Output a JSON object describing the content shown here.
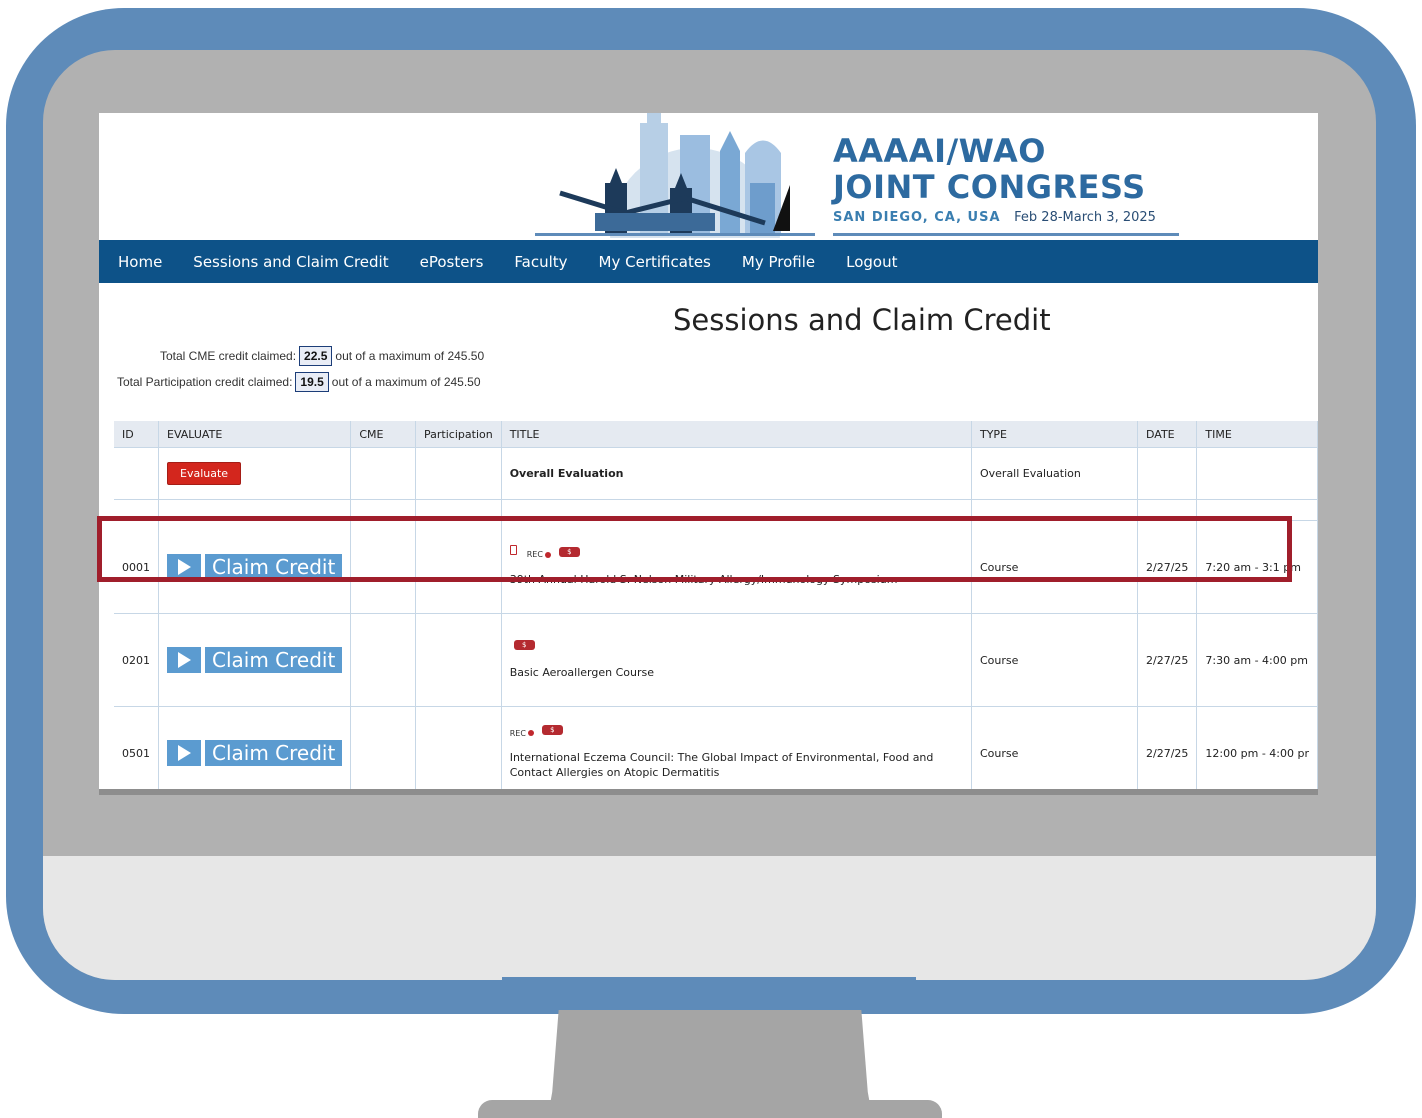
{
  "brand": {
    "line1": "AAAAI/WAO",
    "line2": "JOINT CONGRESS",
    "location": "SAN DIEGO, CA, USA",
    "dates": "Feb 28-March 3, 2025"
  },
  "nav": {
    "items": [
      "Home",
      "Sessions and Claim Credit",
      "ePosters",
      "Faculty",
      "My Certificates",
      "My Profile",
      "Logout"
    ]
  },
  "page_title": "Sessions and Claim Credit",
  "credits": {
    "cme_label": "Total CME credit claimed:",
    "cme_value": "22.5",
    "cme_suffix": "out of a maximum of 245.50",
    "participation_label": "Total Participation credit claimed:",
    "participation_value": "19.5",
    "participation_suffix": "out of a maximum of 245.50"
  },
  "table": {
    "headers": [
      "ID",
      "EVALUATE",
      "CME",
      "Participation",
      "TITLE",
      "TYPE",
      "DATE",
      "TIME"
    ],
    "overall": {
      "button": "Evaluate",
      "title": "Overall Evaluation",
      "type": "Overall Evaluation"
    },
    "rows": [
      {
        "id": "0001",
        "action": "Claim Credit",
        "rec": "REC",
        "badge": "$",
        "title": "39th Annual Harold S. Nelson Military Allergy/Immunology Symposium",
        "type": "Course",
        "date": "2/27/25",
        "time": "7:20 am - 3:1  pm"
      },
      {
        "id": "0201",
        "action": "Claim Credit",
        "badge": "$",
        "title": "Basic Aeroallergen Course",
        "type": "Course",
        "date": "2/27/25",
        "time": "7:30 am - 4:00 pm"
      },
      {
        "id": "0501",
        "action": "Claim Credit",
        "rec": "REC",
        "badge": "$",
        "title": "International Eczema Council: The Global Impact of Environmental, Food and Contact Allergies on Atopic Dermatitis",
        "type": "Course",
        "date": "2/27/25",
        "time": "12:00 pm - 4:00 pr"
      }
    ]
  },
  "colors": {
    "monitor_frame": "#5e8bb9",
    "nav_bar": "#0d5288",
    "claim_button": "#5b9bd0",
    "evaluate_button": "#d3261d",
    "highlight_border": "#a01e2b"
  }
}
